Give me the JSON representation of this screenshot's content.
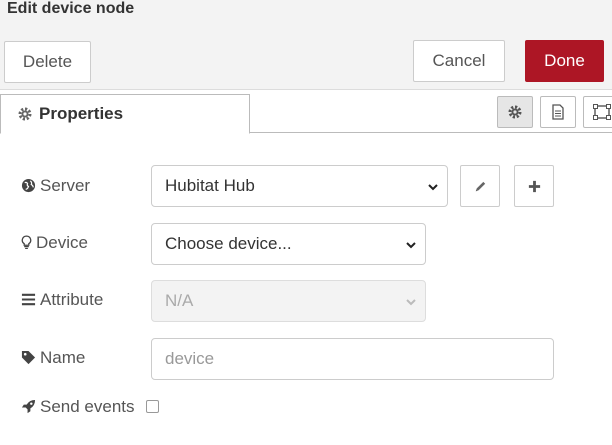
{
  "tray": {
    "title": "Edit device node",
    "delete_label": "Delete",
    "cancel_label": "Cancel",
    "done_label": "Done"
  },
  "tabs": {
    "properties_label": "Properties"
  },
  "form": {
    "server": {
      "label": "Server",
      "value": "Hubitat Hub"
    },
    "device": {
      "label": "Device",
      "value": "Choose device..."
    },
    "attribute": {
      "label": "Attribute",
      "value": "N/A"
    },
    "name": {
      "label": "Name",
      "placeholder": "device"
    },
    "send_events": {
      "label": "Send events",
      "checked": false
    }
  },
  "colors": {
    "done_bg": "#ad1625",
    "text": "#555555"
  }
}
